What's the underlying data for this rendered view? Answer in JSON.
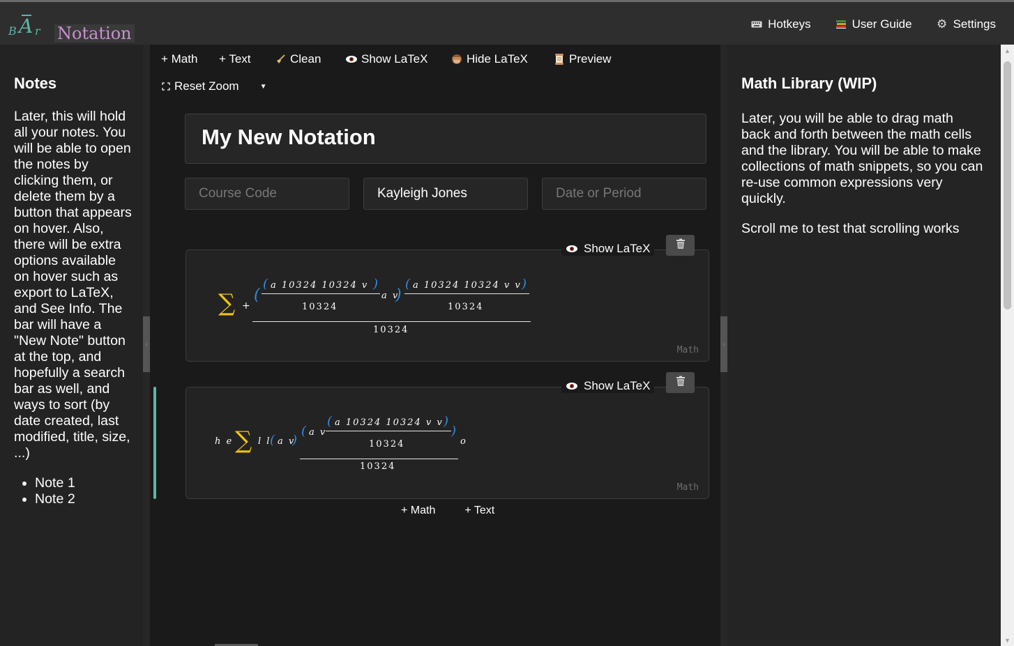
{
  "app": {
    "logo_b": "B",
    "logo_a": "A",
    "logo_r": "r",
    "logo_text": "Notation",
    "accent_color": "#5fb5a8",
    "logo_text_color": "#c98fd1"
  },
  "top_nav": {
    "hotkeys": {
      "label": "Hotkeys",
      "icon": "keyboard-icon"
    },
    "user_guide": {
      "label": "User Guide",
      "icon": "books-icon"
    },
    "settings": {
      "label": "Settings",
      "icon": "gear-icon"
    }
  },
  "left_sidebar": {
    "title": "Notes",
    "body": "Later, this will hold all your notes. You will be able to open the notes by clicking them, or delete them by a button that appears on hover. Also, there will be extra options available on hover such as export to LaTeX, and See Info. The bar will have a \"New Note\" button at the top, and hopefully a search bar as well, and ways to sort (by date created, last modified, title, size, ...)",
    "notes": [
      "Note 1",
      "Note 2"
    ]
  },
  "toolbar": {
    "add_math": "+ Math",
    "add_text": "+ Text",
    "clean": "Clean",
    "show_latex": "Show LaTeX",
    "hide_latex": "Hide LaTeX",
    "preview": "Preview",
    "reset_zoom": "Reset Zoom"
  },
  "document": {
    "title": "My New Notation",
    "course_code_placeholder": "Course Code",
    "author": "Kayleigh Jones",
    "date_placeholder": "Date or Period"
  },
  "cells": [
    {
      "show_latex_label": "Show LaTeX",
      "tag": "Math",
      "math": {
        "plus": "+",
        "num1": "a 10324 10324 v",
        "den1": "10324",
        "mid": "a v",
        "num2": "a 10324 10324 v v",
        "den2": "10324",
        "bottom": "10324"
      }
    },
    {
      "show_latex_label": "Show LaTeX",
      "tag": "Math",
      "math": {
        "pre": "h e",
        "ll": "l l",
        "av": "a v",
        "inner_left": "a v",
        "num": "a 10324 10324 v v",
        "den": "10324",
        "bottom": "10324",
        "tail": "o"
      }
    }
  ],
  "add_row": {
    "add_math": "+ Math",
    "add_text": "+ Text"
  },
  "right_sidebar": {
    "title": "Math Library (WIP)",
    "body": "Later, you will be able to drag math back and forth between the math cells and the library. You will be able to make collections of math snippets, so you can re-use common expressions very quickly.",
    "note": "Scroll me to test that scrolling works"
  }
}
